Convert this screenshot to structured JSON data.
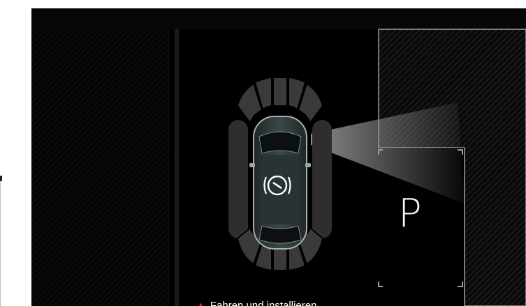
{
  "screen": {
    "parking_spot_label": "P",
    "parking_status": "active",
    "warning": {
      "icon": "warning-icon",
      "text": "Fahren und installieren"
    },
    "vehicle": {
      "indicator_icon": "parking-brake-icon"
    },
    "colors": {
      "background": "#000000",
      "sensor_segment": "#3a3a3a",
      "warning_icon": "#e0202a",
      "car_body": "#2f3a3a"
    }
  }
}
